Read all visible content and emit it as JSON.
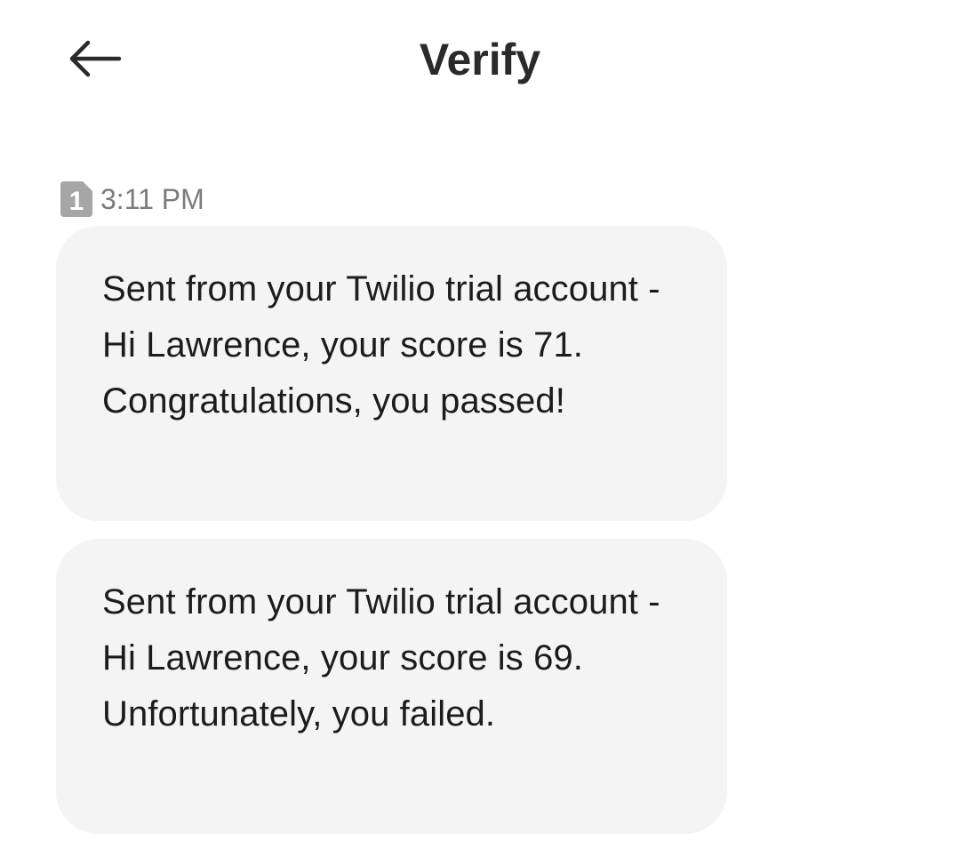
{
  "header": {
    "title": "Verify",
    "back_icon": "arrow-left-icon"
  },
  "conversation": {
    "sim_slot": "1",
    "timestamp": "3:11 PM",
    "messages": [
      {
        "text": "Sent from your Twilio trial account - Hi Lawrence, your score is 71. Congratulations, you passed!"
      },
      {
        "text": "Sent from your Twilio trial account - Hi Lawrence, your score is 69. Unfortunately, you failed."
      }
    ]
  },
  "colors": {
    "background": "#ffffff",
    "bubble": "#f4f4f4",
    "text": "#1c1c1c",
    "meta_text": "#7b7b7b",
    "sim_badge": "#a6a6a6"
  }
}
